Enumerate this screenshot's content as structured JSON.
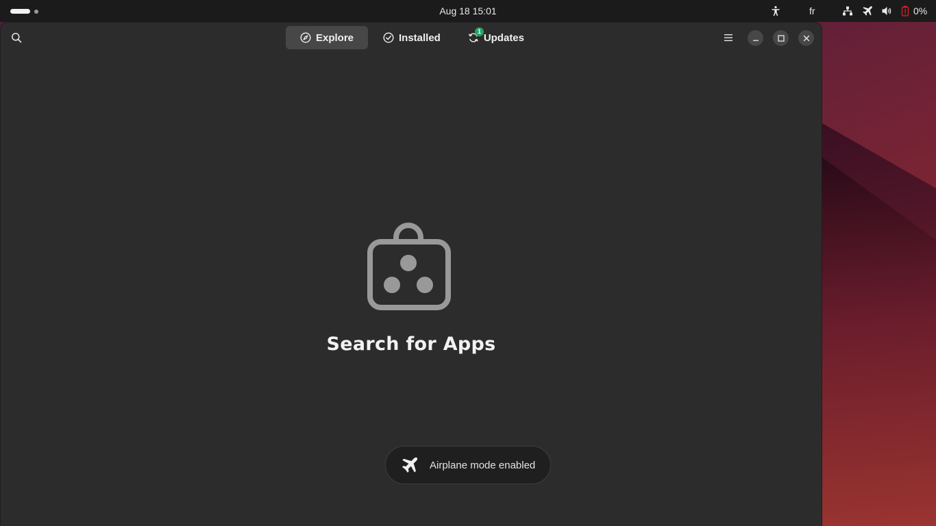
{
  "topbar": {
    "clock": "Aug 18  15:01",
    "language": "fr",
    "battery_percent": "0%",
    "icons": [
      "accessibility-icon",
      "network-icon",
      "airplane-icon",
      "volume-icon",
      "battery-empty-icon"
    ]
  },
  "headerbar": {
    "tabs": [
      {
        "label": "Explore",
        "icon": "compass-icon",
        "active": true
      },
      {
        "label": "Installed",
        "icon": "check-circle-icon",
        "active": false
      },
      {
        "label": "Updates",
        "icon": "refresh-icon",
        "active": false,
        "badge": "1"
      }
    ]
  },
  "main": {
    "empty_title": "Search for Apps",
    "empty_icon": "shopping-bag-icon"
  },
  "toast": {
    "text": "Airplane mode enabled",
    "icon": "airplane-icon"
  },
  "colors": {
    "window_bg": "#2c2c2c",
    "topbar_bg": "#1b1b1b",
    "badge": "#26a269",
    "battery_warning": "#e01b24"
  }
}
